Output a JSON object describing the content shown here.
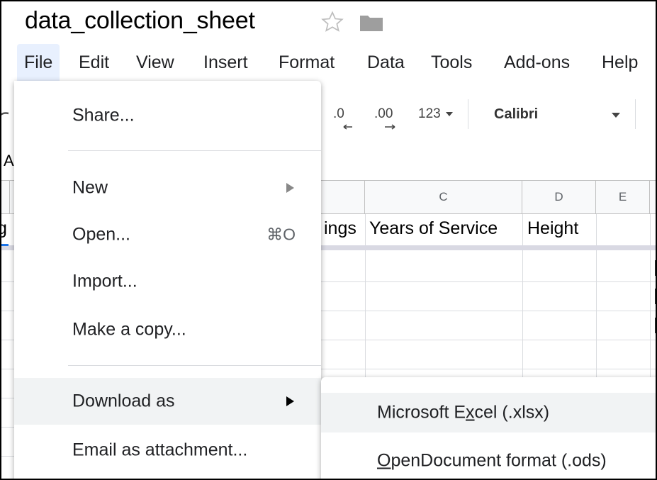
{
  "document": {
    "title": "data_collection_sheet"
  },
  "menubar": {
    "items": [
      "File",
      "Edit",
      "View",
      "Insert",
      "Format",
      "Data",
      "Tools",
      "Add-ons",
      "Help"
    ]
  },
  "toolbar": {
    "decrease_decimal": ".0",
    "increase_decimal": ".00",
    "number_format": "123",
    "font": "Calibri"
  },
  "formula_bar": {
    "cell_ref_fragment": "A"
  },
  "grid": {
    "column_headers": [
      "C",
      "D",
      "E"
    ],
    "header_row": [
      "ings",
      "Years of Service",
      "Height"
    ],
    "left_fragment": "g"
  },
  "file_menu": {
    "items": [
      {
        "label": "Share..."
      },
      {
        "label": "New"
      },
      {
        "label": "Open...",
        "shortcut": "⌘O"
      },
      {
        "label": "Import..."
      },
      {
        "label": "Make a copy..."
      },
      {
        "label": "Download as"
      },
      {
        "label": "Email as attachment..."
      }
    ]
  },
  "download_submenu": {
    "items": [
      {
        "pre": "Microsoft E",
        "u": "x",
        "post": "cel (.xlsx)"
      },
      {
        "pre": "",
        "u": "O",
        "post": "penDocument format (.ods)"
      }
    ]
  }
}
